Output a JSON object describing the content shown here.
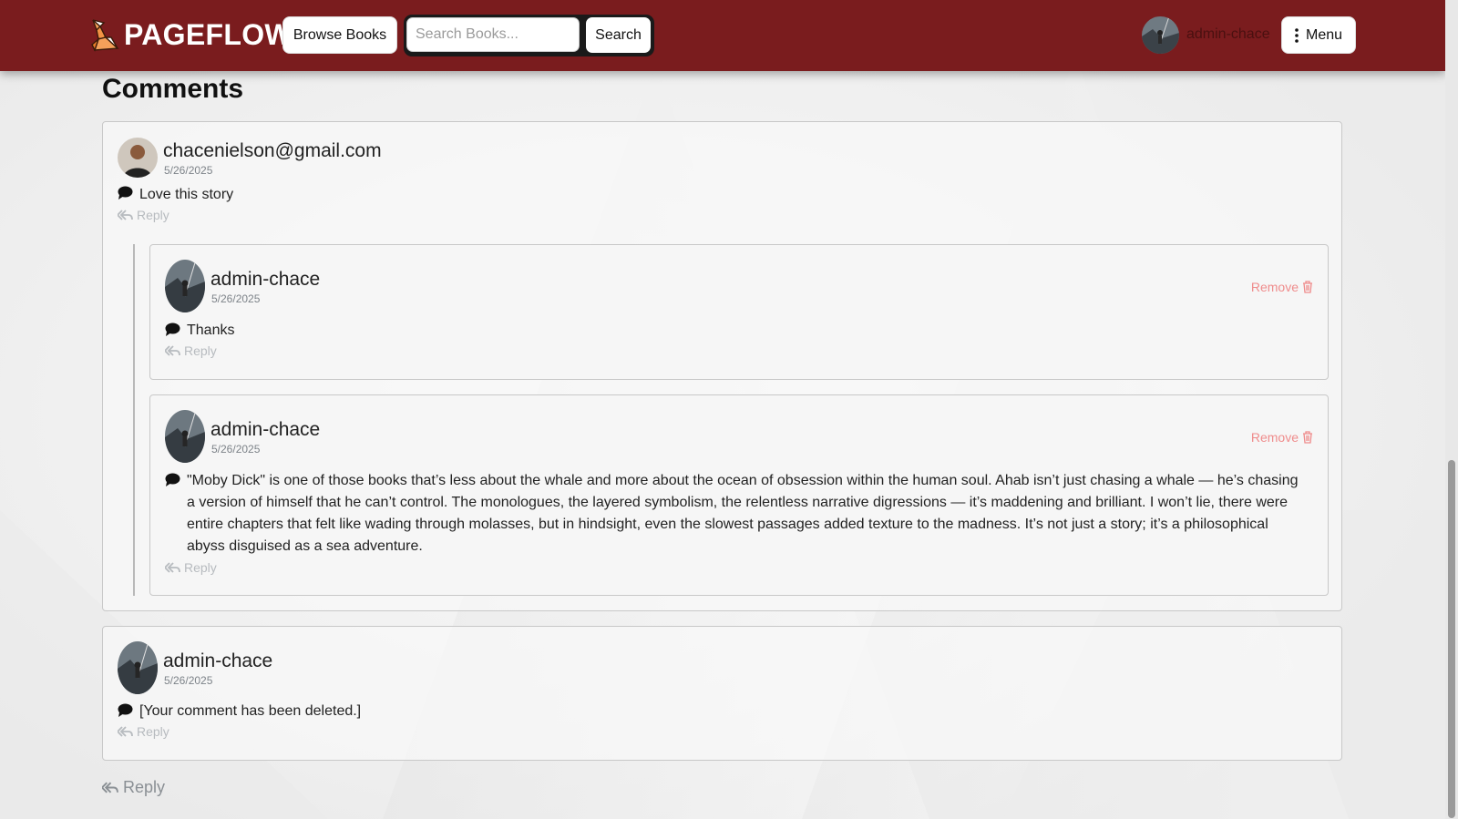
{
  "nav": {
    "brand": "PAGEFLOW",
    "browse_label": "Browse Books",
    "search_placeholder": "Search Books...",
    "search_label": "Search",
    "username": "admin-chace",
    "menu_label": "Menu"
  },
  "comments_title": "Comments",
  "thread": {
    "root": {
      "user": "chacenielson@gmail.com",
      "date": "5/26/2025",
      "text": "Love this story",
      "reply": "Reply"
    },
    "replies": [
      {
        "user": "admin-chace",
        "date": "5/26/2025",
        "text": "Thanks",
        "reply": "Reply",
        "remove": "Remove"
      },
      {
        "user": "admin-chace",
        "date": "5/26/2025",
        "text": "\"Moby Dick\" is one of those books that’s less about the whale and more about the ocean of obsession within the human soul. Ahab isn’t just chasing a whale — he’s chasing a version of himself that he can’t control. The monologues, the layered symbolism, the relentless narrative digressions — it’s maddening and brilliant. I won’t lie, there were entire chapters that felt like wading through molasses, but in hindsight, even the slowest passages added texture to the madness. It’s not just a story; it’s a philosophical abyss disguised as a sea adventure.",
        "reply": "Reply",
        "remove": "Remove"
      }
    ]
  },
  "second_comment": {
    "user": "admin-chace",
    "date": "5/26/2025",
    "text": "[Your comment has been deleted.]",
    "reply": "Reply"
  },
  "bottom_reply": "Reply",
  "colors": {
    "navbar": "#7a1c1e",
    "remove": "#ef8c8c",
    "muted": "#b7bbbf"
  }
}
